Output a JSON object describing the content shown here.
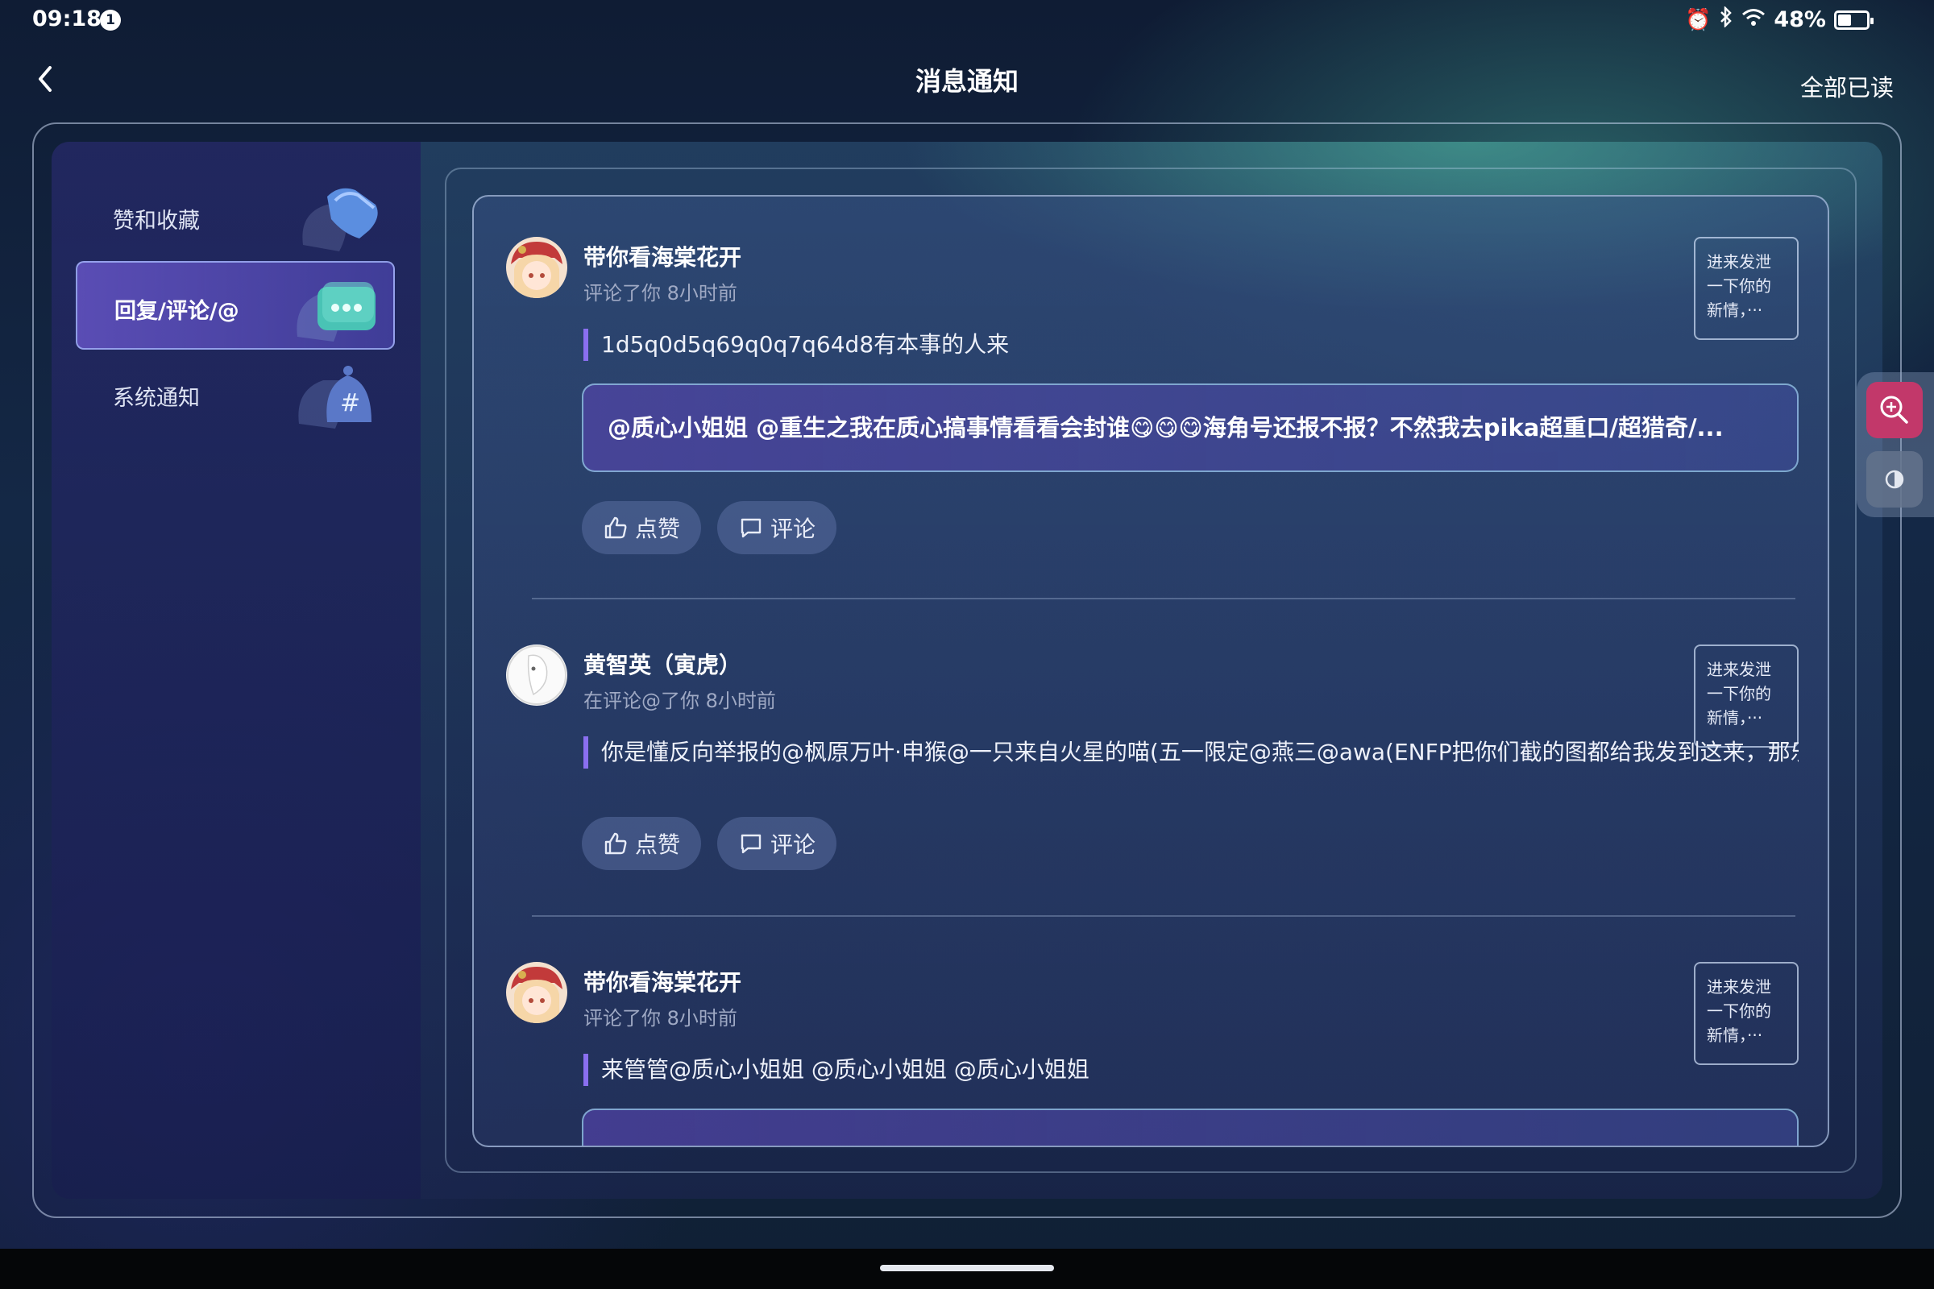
{
  "status_bar": {
    "time": "09:18",
    "notification_badge": "1",
    "battery_text": "48%",
    "battery_level": 0.48,
    "icons": [
      "alarm-icon",
      "bluetooth-icon",
      "wifi-icon",
      "battery-icon"
    ]
  },
  "header": {
    "title": "消息通知",
    "mark_all_read": "全部已读"
  },
  "sidebar": {
    "items": [
      {
        "label": "赞和收藏",
        "icon": "heart-bookmark-icon",
        "active": false
      },
      {
        "label": "回复/评论/@",
        "icon": "chat-bubble-icon",
        "active": true
      },
      {
        "label": "系统通知",
        "icon": "bell-hash-icon",
        "active": false
      }
    ]
  },
  "messages": [
    {
      "user": "带你看海棠花开",
      "meta": "评论了你 8小时前",
      "quote": "1d5q0d5q69q0q7q64d8有本事的人来",
      "reply": "@质心小姐姐 @重生之我在质心搞事情看看会封谁😋😋😋海角号还报不报？不然我去pika超重口/超猎奇/...",
      "thumb": [
        "进来发泄",
        "一下你的",
        "新情，···"
      ],
      "like_label": "点赞",
      "comment_label": "评论"
    },
    {
      "user": "黄智英（寅虎）",
      "meta": "在评论@了你 8小时前",
      "quote": "你是懂反向举报的@枫原万叶·申猴@一只来自火星的喵(五一限定@燕三@awa(ENFP把你们截的图都给我发到这来，那乐-",
      "thumb": [
        "进来发泄",
        "一下你的",
        "新情，···"
      ],
      "like_label": "点赞",
      "comment_label": "评论"
    },
    {
      "user": "带你看海棠花开",
      "meta": "评论了你 8小时前",
      "quote": "来管管@质心小姐姐 @质心小姐姐 @质心小姐姐",
      "thumb": [
        "进来发泄",
        "一下你的",
        "新情，···"
      ]
    }
  ],
  "colors": {
    "accent": "#8a6ff0",
    "zoom_button": "#c2386a",
    "background": "#142846"
  }
}
